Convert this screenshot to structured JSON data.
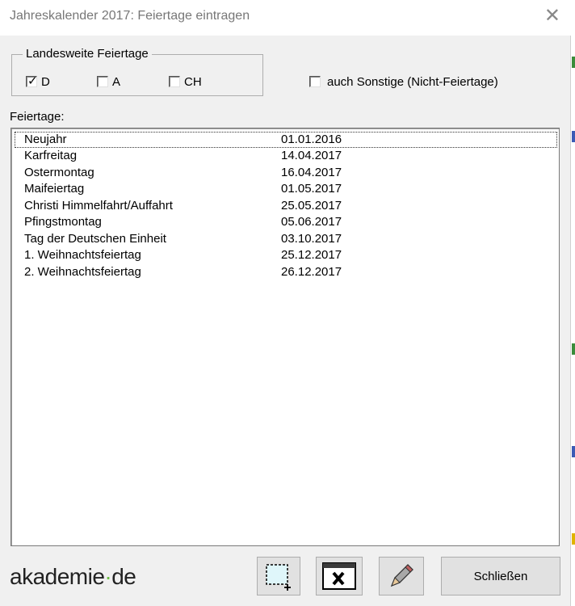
{
  "window": {
    "title": "Jahreskalender 2017: Feiertage eintragen",
    "close_symbol": "✕"
  },
  "groupbox": {
    "legend": "Landesweite Feiertage",
    "checkboxes": [
      {
        "label": "D",
        "checked": true
      },
      {
        "label": "A",
        "checked": false
      },
      {
        "label": "CH",
        "checked": false
      }
    ]
  },
  "other_checkbox": {
    "label": "auch Sonstige (Nicht-Feiertage)",
    "checked": false
  },
  "list": {
    "label": "Feiertage:",
    "rows": [
      {
        "name": "Neujahr",
        "date": "01.01.2016"
      },
      {
        "name": "Karfreitag",
        "date": "14.04.2017"
      },
      {
        "name": "Ostermontag",
        "date": "16.04.2017"
      },
      {
        "name": "Maifeiertag",
        "date": "01.05.2017"
      },
      {
        "name": "Christi Himmelfahrt/Auffahrt",
        "date": "25.05.2017"
      },
      {
        "name": "Pfingstmontag",
        "date": "05.06.2017"
      },
      {
        "name": "Tag der Deutschen Einheit",
        "date": "03.10.2017"
      },
      {
        "name": "1. Weihnachtsfeiertag",
        "date": "25.12.2017"
      },
      {
        "name": "2. Weihnachtsfeiertag",
        "date": "26.12.2017"
      }
    ]
  },
  "logo": {
    "part1": "akademie",
    "dot": "·",
    "part2": "de"
  },
  "buttons": {
    "add_icon": "add-entry-icon",
    "delete_icon": "delete-entry-icon",
    "edit_icon": "pencil-icon",
    "close_label": "Schließen"
  },
  "colors": {
    "logo_dot": "#6dbe45",
    "selection_outline": "#333333"
  }
}
